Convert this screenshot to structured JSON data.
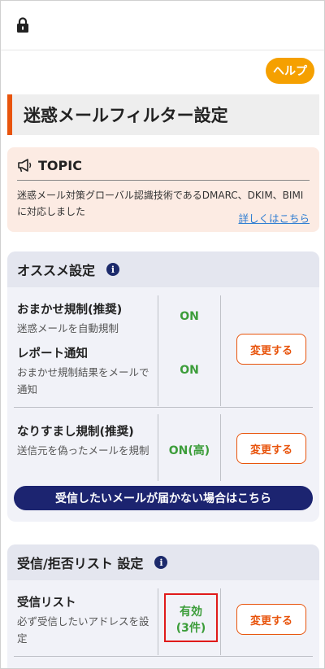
{
  "help_label": "ヘルプ",
  "page_title": "迷惑メールフィルター設定",
  "topic": {
    "icon": "megaphone-icon",
    "title": "TOPIC",
    "text": "迷惑メール対策グローバル認識技術であるDMARC、DKIM、BIMIに対応しました",
    "link": "詳しくはこちら"
  },
  "recommend": {
    "title": "オススメ設定",
    "info_icon": "i",
    "items": [
      {
        "title": "おまかせ規制(推奨)",
        "desc": "迷惑メールを自動規制",
        "status": "ON"
      },
      {
        "title": "レポート通知",
        "desc": "おまかせ規制結果をメールで通知",
        "status": "ON"
      },
      {
        "title": "なりすまし規制(推奨)",
        "desc": "送信元を偽ったメールを規制",
        "status": "ON(高)"
      }
    ],
    "change_label": "変更する",
    "bottom_button": "受信したいメールが届かない場合はこちら"
  },
  "lists": {
    "title": "受信/拒否リスト 設定",
    "info_icon": "i",
    "items": [
      {
        "title": "受信リスト",
        "desc": "必ず受信したいアドレスを設定",
        "status_line1": "有効",
        "status_line2": "(3件)"
      }
    ],
    "change_label": "変更する"
  },
  "colors": {
    "accent_orange": "#e8540c",
    "help_orange": "#f5a000",
    "status_green": "#3c9d3a",
    "navy": "#1c2470",
    "highlight_red": "#e01a1a"
  }
}
